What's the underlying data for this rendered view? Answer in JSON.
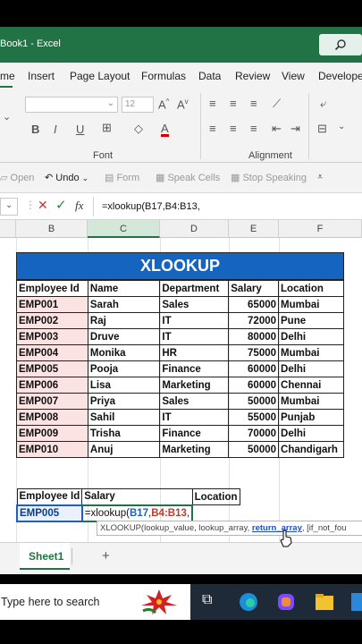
{
  "window": {
    "title": "Book1  -  Excel"
  },
  "menu": {
    "items": [
      "me",
      "Insert",
      "Page Layout",
      "Formulas",
      "Data",
      "Review",
      "View",
      "Develope"
    ]
  },
  "ribbon": {
    "font_size": "12",
    "font_group_label": "Font",
    "alignment_group_label": "Alignment"
  },
  "qat": {
    "open": "Open",
    "undo": "Undo",
    "form": "Form",
    "speak_cells": "Speak Cells",
    "stop_speaking": "Stop Speaking"
  },
  "formula_bar": {
    "fx": "fx",
    "formula": "=xlookup(B17,B4:B13,"
  },
  "columns": [
    "B",
    "C",
    "D",
    "E",
    "F"
  ],
  "table": {
    "title": "XLOOKUP",
    "headers": [
      "Employee Id",
      "Name",
      "Department",
      "Salary",
      "Location"
    ],
    "rows": [
      [
        "EMP001",
        "Sarah",
        "Sales",
        "65000",
        "Mumbai"
      ],
      [
        "EMP002",
        "Raj",
        "IT",
        "72000",
        "Pune"
      ],
      [
        "EMP003",
        "Druve",
        "IT",
        "80000",
        "Delhi"
      ],
      [
        "EMP004",
        "Monika",
        "HR",
        "75000",
        "Mumbai"
      ],
      [
        "EMP005",
        "Pooja",
        "Finance",
        "60000",
        "Delhi"
      ],
      [
        "EMP006",
        "Lisa",
        "Marketing",
        "60000",
        "Chennai"
      ],
      [
        "EMP007",
        "Priya",
        "Sales",
        "50000",
        "Mumbai"
      ],
      [
        "EMP008",
        "Sahil",
        "IT",
        "55000",
        "Punjab"
      ],
      [
        "EMP009",
        "Trisha",
        "Finance",
        "70000",
        "Delhi"
      ],
      [
        "EMP010",
        "Anuj",
        "Marketing",
        "50000",
        "Chandigarh"
      ]
    ]
  },
  "lookup": {
    "headers": [
      "Employee Id",
      "Salary",
      "Location"
    ],
    "id_value": "EMP005",
    "formula_parts": [
      "=xlookup(",
      "B17",
      ",",
      "B4:B13",
      ","
    ]
  },
  "tooltip": {
    "fn": "XLOOKUP(",
    "arg1": "lookup_value, ",
    "arg2": "lookup_array, ",
    "arg3": "return_array",
    "rest": ", [if_not_fou"
  },
  "sheet_tab": "Sheet1",
  "add_sheet": "+",
  "taskbar": {
    "search_placeholder": "Type here to search"
  },
  "colors": {
    "excel_green": "#217346",
    "title_banner": "#1565c0",
    "id_highlight": "#fbe3e3"
  }
}
